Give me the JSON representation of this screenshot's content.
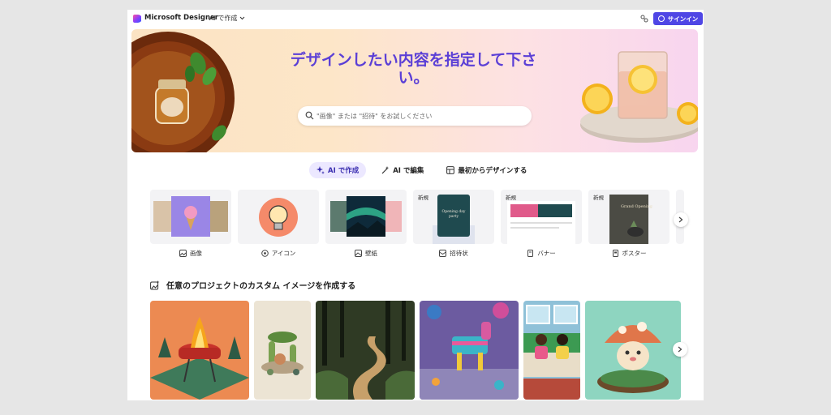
{
  "header": {
    "brand": "Microsoft Designer",
    "ai_menu": "AI で作成",
    "signin": "サインイン"
  },
  "hero": {
    "title": "デザインしたい内容を指定して下さい。",
    "search_placeholder": "\"画像\" または \"招待\" をお試しください"
  },
  "tabs": [
    {
      "label": "AI で作成",
      "icon": "sparkle-icon",
      "active": true
    },
    {
      "label": "AI で編集",
      "icon": "magic-wand-icon",
      "active": false
    },
    {
      "label": "最初からデザインする",
      "icon": "layout-icon",
      "active": false
    }
  ],
  "cards": [
    {
      "label": "画像",
      "icon": "image-icon"
    },
    {
      "label": "アイコン",
      "icon": "icon-icon"
    },
    {
      "label": "壁紙",
      "icon": "wallpaper-icon"
    },
    {
      "label": "招待状",
      "icon": "invitation-icon",
      "badge": "新規",
      "inner_text": "Opening day party"
    },
    {
      "label": "バナー",
      "icon": "banner-icon",
      "badge": "新規"
    },
    {
      "label": "ポスター",
      "icon": "poster-icon",
      "badge": "新規",
      "inner_text": "Grand Opening"
    }
  ],
  "section": {
    "title": "任意のプロジェクトのカスタム イメージを作成する"
  },
  "colors": {
    "accent": "#4f46e5",
    "title": "#5b3fd6",
    "tab_active_bg": "#ece8ff"
  }
}
